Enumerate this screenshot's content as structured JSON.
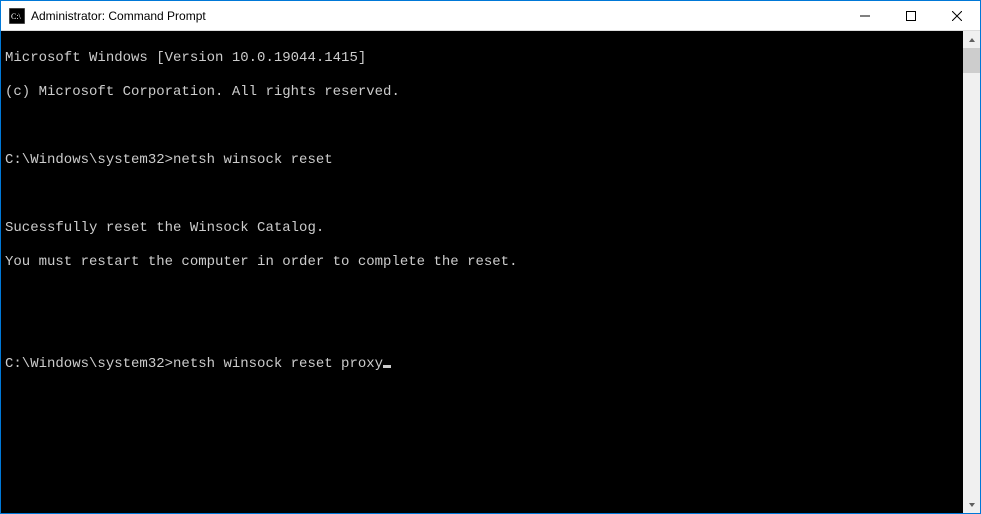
{
  "window": {
    "title": "Administrator: Command Prompt"
  },
  "console": {
    "version_line": "Microsoft Windows [Version 10.0.19044.1415]",
    "copyright_line": "(c) Microsoft Corporation. All rights reserved.",
    "prompt1_path": "C:\\Windows\\system32>",
    "prompt1_cmd": "netsh winsock reset",
    "output_line1": "Sucessfully reset the Winsock Catalog.",
    "output_line2": "You must restart the computer in order to complete the reset.",
    "prompt2_path": "C:\\Windows\\system32>",
    "prompt2_cmd": "netsh winsock reset proxy"
  }
}
